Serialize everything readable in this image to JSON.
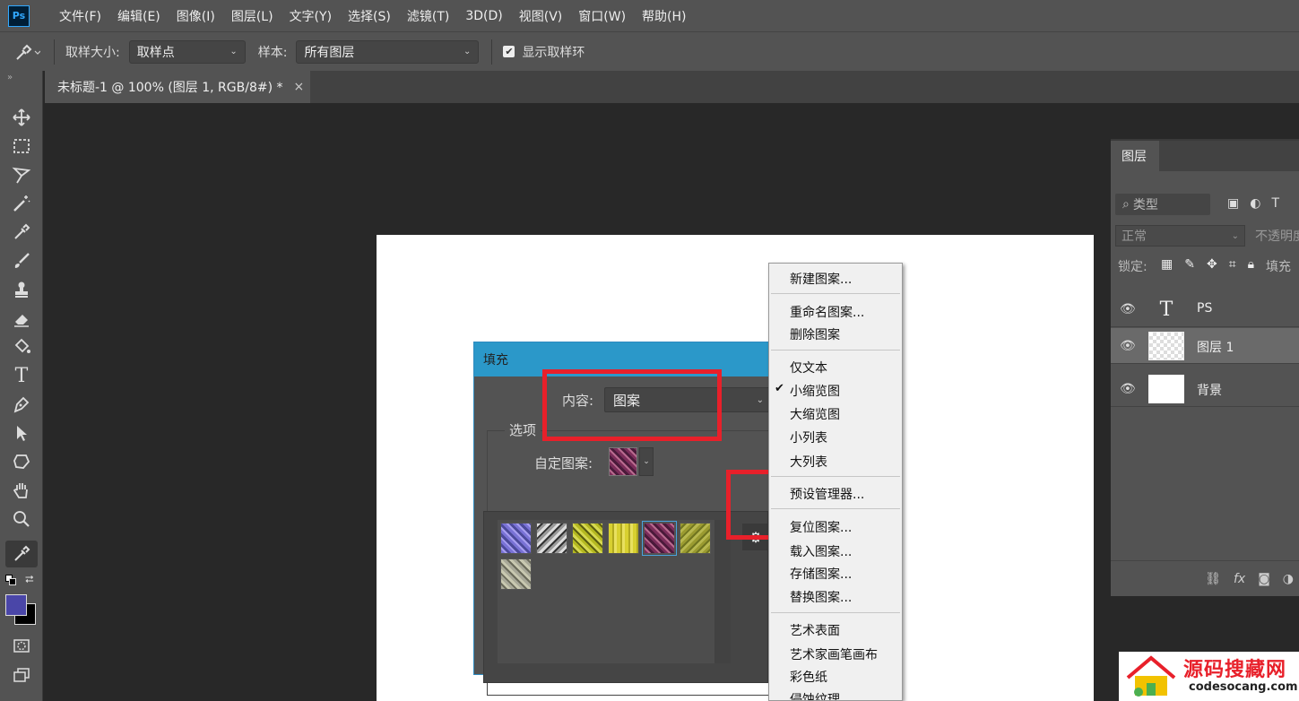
{
  "app": {
    "logo": "Ps"
  },
  "menubar": [
    "文件(F)",
    "编辑(E)",
    "图像(I)",
    "图层(L)",
    "文字(Y)",
    "选择(S)",
    "滤镜(T)",
    "3D(D)",
    "视图(V)",
    "窗口(W)",
    "帮助(H)"
  ],
  "options": {
    "tool_icon": "eyedropper-icon",
    "sample_size_label": "取样大小:",
    "sample_size_value": "取样点",
    "sample_label": "样本:",
    "sample_value": "所有图层",
    "show_ring_label": "显示取样环",
    "show_ring_checked": true
  },
  "document_tab": {
    "title": "未标题-1 @ 100% (图层 1, RGB/8#) *",
    "close": "×"
  },
  "toolbar": {
    "foreground_color": "#4a46a8",
    "background_color": "#000000",
    "tools": [
      "move-icon",
      "marquee-icon",
      "lasso-icon",
      "magic-wand-icon",
      "eyedropper-retouch-icon",
      "brush-icon",
      "stamp-icon",
      "eraser-icon",
      "paint-bucket-icon",
      "type-icon",
      "pen-icon",
      "path-select-icon",
      "shape-icon",
      "hand-icon",
      "zoom-icon",
      "eyedropper-icon"
    ]
  },
  "fill_dialog": {
    "title": "填充",
    "content_label": "内容:",
    "content_value": "图案",
    "options_legend": "选项",
    "custom_pattern_label": "自定图案:",
    "selected_pattern_index": 4
  },
  "context_menu": {
    "items": [
      {
        "label": "新建图案..."
      },
      {
        "label": "重命名图案..."
      },
      {
        "label": "删除图案"
      },
      {
        "label": "仅文本"
      },
      {
        "label": "小缩览图",
        "checked": true
      },
      {
        "label": "大缩览图"
      },
      {
        "label": "小列表"
      },
      {
        "label": "大列表"
      },
      {
        "label": "预设管理器..."
      },
      {
        "label": "复位图案..."
      },
      {
        "label": "载入图案..."
      },
      {
        "label": "存储图案..."
      },
      {
        "label": "替换图案..."
      },
      {
        "label": "艺术表面"
      },
      {
        "label": "艺术家画笔画布"
      },
      {
        "label": "彩色纸"
      },
      {
        "label": "侵蚀纹理"
      }
    ]
  },
  "layers_panel": {
    "tab": "图层",
    "filter_placeholder": "类型",
    "blend_mode": "正常",
    "opacity_label": "不透明度",
    "lock_label": "锁定:",
    "fill_label": "填充",
    "layers": [
      {
        "name": "PS",
        "kind": "text",
        "selected": false
      },
      {
        "name": "图层 1",
        "kind": "transparent",
        "selected": true
      },
      {
        "name": "背景",
        "kind": "white",
        "selected": false
      }
    ]
  },
  "watermark": {
    "title": "源码搜藏网",
    "url": "codesocang.com"
  }
}
